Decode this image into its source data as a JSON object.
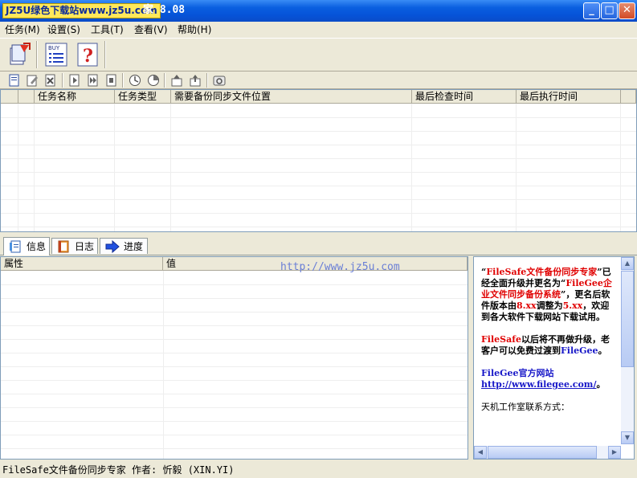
{
  "window": {
    "title_overlay": "JZ5U绿色下载站www.jz5u.com",
    "title_text": "家 8.08",
    "minimize": "_",
    "maximize": "□",
    "close": "✕"
  },
  "menu": [
    {
      "label": "任务(M)"
    },
    {
      "label": "设置(S)"
    },
    {
      "label": "工具(T)"
    },
    {
      "label": "查看(V)"
    },
    {
      "label": "帮助(H)"
    }
  ],
  "toolbar_big": [
    {
      "icon": "new-task-icon"
    },
    {
      "icon": "buy-list-icon",
      "label": "BUY"
    },
    {
      "icon": "help-icon",
      "label": "?"
    }
  ],
  "table": {
    "headers": [
      "任务名称",
      "任务类型",
      "需要备份同步文件位置",
      "最后检查时间",
      "最后执行时间"
    ]
  },
  "tabs": [
    {
      "label": "信息",
      "icon": "info-page-icon"
    },
    {
      "label": "日志",
      "icon": "log-book-icon"
    },
    {
      "label": "进度",
      "icon": "progress-arrow-icon"
    }
  ],
  "props": {
    "headers": [
      "属性",
      "值"
    ],
    "watermark": "http://www.jz5u.com"
  },
  "info": {
    "p1_q_open": "“",
    "p1_name": "FileSafe文件备份同步专家",
    "p1_mid": "”已经全面升级并更名为“",
    "p1_new": "FileGee企业文件同步备份系统",
    "p1_after": "”，更名后软件版本由",
    "p1_v1": "8.xx",
    "p1_mid2": "调整为",
    "p1_v2": "5.xx",
    "p1_end": "，欢迎到各大软件下载网站下载试用。",
    "p2_name": "FileSafe",
    "p2_text": "以后将不再做升级，老客户可以免费过渡到",
    "p2_target": "FileGee",
    "p2_end": "。",
    "p3_text": "FileGee官方网站",
    "p3_link": "http://www.filegee.com/",
    "p3_end": "。",
    "p4_text": "天机工作室联系方式："
  },
  "status": "FileSafe文件备份同步专家  作者: 忻毅 (XIN.YI)"
}
